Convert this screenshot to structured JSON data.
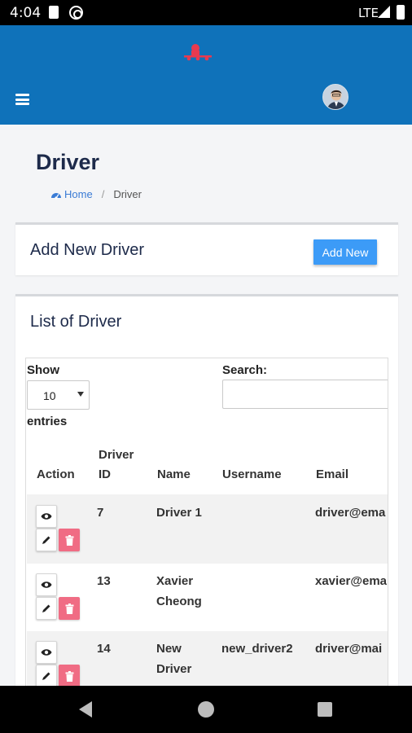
{
  "status_bar": {
    "time": "4:04",
    "network": "LTE"
  },
  "page": {
    "title": "Driver",
    "breadcrumb": {
      "home": "Home",
      "separator": "/",
      "current": "Driver"
    }
  },
  "add_card": {
    "title": "Add New Driver",
    "button_label": "Add New"
  },
  "list_card": {
    "title": "List of Driver",
    "controls": {
      "show_label": "Show",
      "length_value": "10",
      "entries_label": "entries",
      "search_label": "Search:",
      "search_value": ""
    },
    "columns": [
      "Action",
      "Driver ID",
      "Name",
      "Username",
      "Email"
    ],
    "rows": [
      {
        "id": "7",
        "name": "Driver 1",
        "username": "",
        "email": "driver@ema"
      },
      {
        "id": "13",
        "name": "Xavier Cheong",
        "username": "",
        "email": "xavier@ema"
      },
      {
        "id": "14",
        "name": "New Driver",
        "username": "new_driver2",
        "email": "driver@mai"
      }
    ]
  },
  "icons": {
    "menu": "hamburger-icon",
    "home": "home-icon",
    "view": "eye-icon",
    "edit": "pencil-icon",
    "delete": "trash-icon"
  },
  "colors": {
    "header": "#0f72ba",
    "primary_button": "#3c9bf7",
    "delete_button": "#f06c84",
    "title_text": "#1d2a4a"
  }
}
